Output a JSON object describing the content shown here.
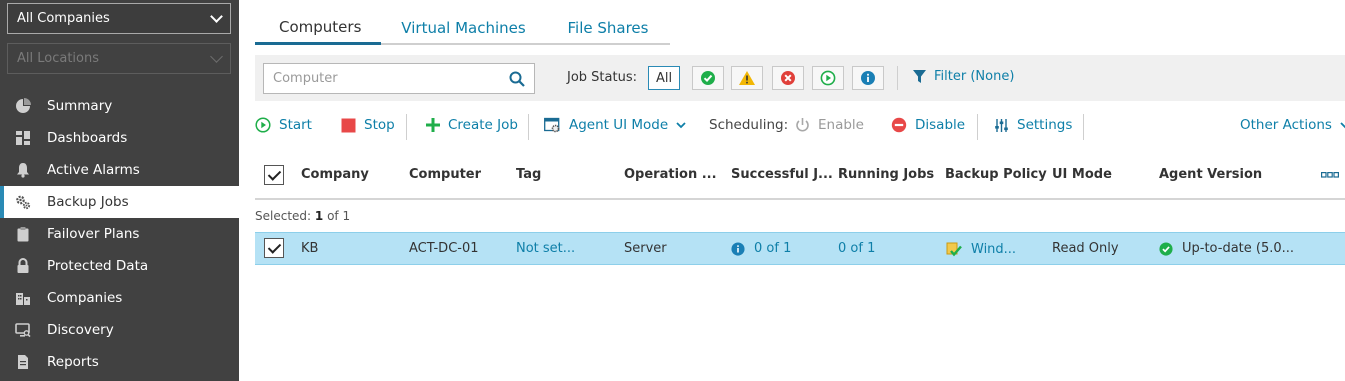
{
  "sidebar": {
    "company_select": "All Companies",
    "location_select": "All Locations",
    "items": [
      {
        "label": "Summary",
        "icon": "pie-chart-icon"
      },
      {
        "label": "Dashboards",
        "icon": "dashboard-grid-icon"
      },
      {
        "label": "Active Alarms",
        "icon": "bell-icon"
      },
      {
        "label": "Backup Jobs",
        "icon": "gears-icon",
        "active": true
      },
      {
        "label": "Failover Plans",
        "icon": "clipboard-icon"
      },
      {
        "label": "Protected Data",
        "icon": "lock-icon"
      },
      {
        "label": "Companies",
        "icon": "buildings-icon"
      },
      {
        "label": "Discovery",
        "icon": "monitor-search-icon"
      },
      {
        "label": "Reports",
        "icon": "document-icon"
      }
    ]
  },
  "tabs": [
    {
      "label": "Computers",
      "active": true
    },
    {
      "label": "Virtual Machines"
    },
    {
      "label": "File Shares"
    }
  ],
  "filterbar": {
    "search_placeholder": "Computer",
    "job_status_label": "Job Status:",
    "all_label": "All",
    "filter_label": "Filter (None)"
  },
  "toolbar": {
    "start": "Start",
    "stop": "Stop",
    "create_job": "Create Job",
    "agent_ui_mode": "Agent UI Mode",
    "scheduling_label": "Scheduling:",
    "enable": "Enable",
    "disable": "Disable",
    "settings": "Settings",
    "other_actions": "Other Actions"
  },
  "table": {
    "columns": [
      "Company",
      "Computer",
      "Tag",
      "Operation ...",
      "Successful J...",
      "Running Jobs",
      "Backup Policy",
      "UI Mode",
      "Agent Version"
    ],
    "selected_prefix": "Selected:",
    "selected_count": "1",
    "selected_suffix": "of 1",
    "rows": [
      {
        "company": "KB",
        "computer": "ACT-DC-01",
        "tag": "Not set...",
        "operation": "Server",
        "successful_jobs": "0 of 1",
        "running_jobs": "0 of 1",
        "backup_policy": "Wind...",
        "ui_mode": "Read Only",
        "agent_version": "Up-to-date (5.0..."
      }
    ]
  },
  "colors": {
    "sidebar_bg": "#414141",
    "accent": "#0e7fa8",
    "row_selected": "#b5e2f5",
    "success": "#1fae4a",
    "warning": "#f2b705",
    "error": "#e0403a"
  }
}
